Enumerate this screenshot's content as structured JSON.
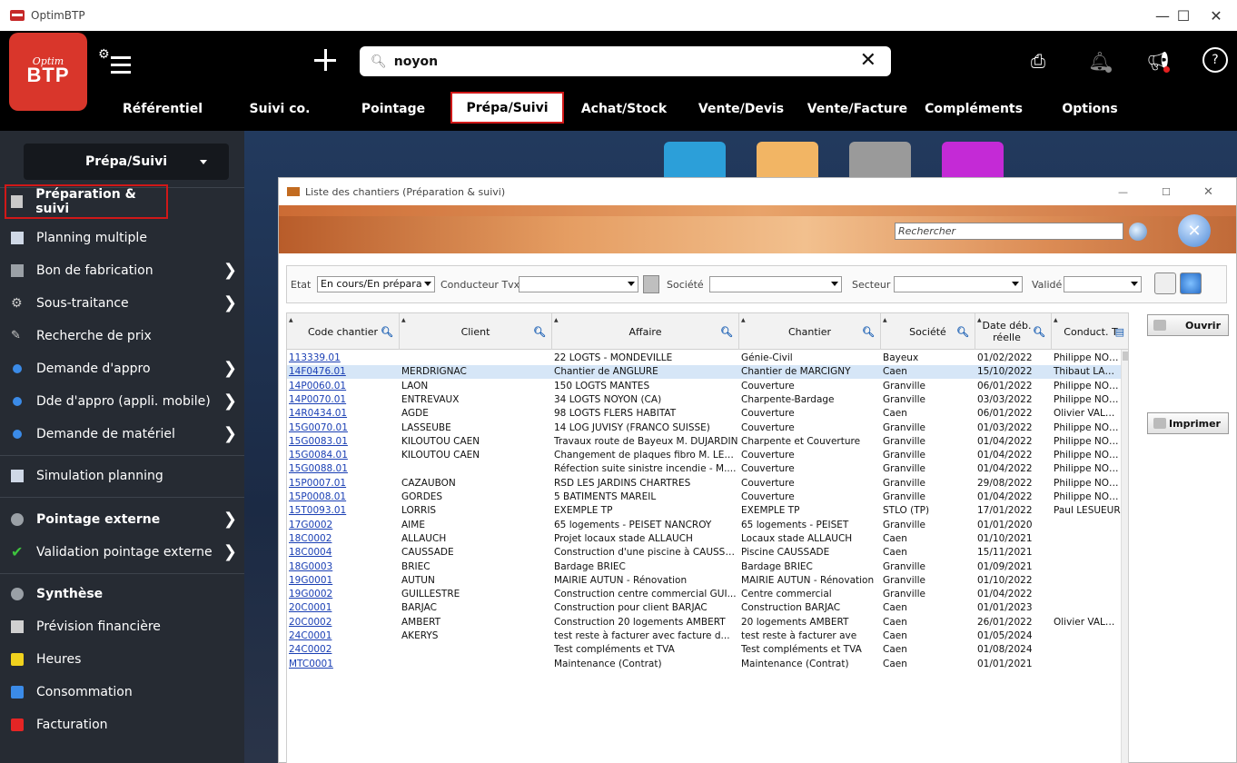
{
  "app": {
    "title": "OptimBTP",
    "logo_small": "Optim",
    "logo_big": "BTP"
  },
  "search": {
    "value": "noyon",
    "placeholder": ""
  },
  "nav": [
    {
      "label": "Référentiel"
    },
    {
      "label": "Suivi co."
    },
    {
      "label": "Pointage"
    },
    {
      "label": "Prépa/Suivi"
    },
    {
      "label": "Achat/Stock"
    },
    {
      "label": "Vente/Devis"
    },
    {
      "label": "Vente/Facture"
    },
    {
      "label": "Compléments"
    },
    {
      "label": "Options"
    }
  ],
  "sidebar": {
    "dropdown": "Prépa/Suivi",
    "items": [
      {
        "label": "Préparation & suivi",
        "icon": "folder-icon"
      },
      {
        "label": "Planning multiple",
        "icon": "planning-icon"
      },
      {
        "label": "Bon de fabrication",
        "icon": "factory-icon"
      },
      {
        "label": "Sous-traitance",
        "icon": "gear-icon"
      },
      {
        "label": "Recherche de prix",
        "icon": "tag-icon"
      },
      {
        "label": "Demande d'appro",
        "icon": "circle-icon"
      },
      {
        "label": "Dde d'appro (appli. mobile)",
        "icon": "circle-icon"
      },
      {
        "label": "Demande de matériel",
        "icon": "circle-icon"
      },
      {
        "label": "Simulation planning",
        "icon": "planning-icon"
      },
      {
        "label": "Pointage externe",
        "icon": "clock-icon"
      },
      {
        "label": "Validation pointage externe",
        "icon": "check-icon"
      },
      {
        "label": "Synthèse",
        "icon": "chart-icon"
      },
      {
        "label": "Prévision financière",
        "icon": "calc-icon"
      },
      {
        "label": "Heures",
        "icon": "yellow-square-icon"
      },
      {
        "label": "Consommation",
        "icon": "blue-square-icon"
      },
      {
        "label": "Facturation",
        "icon": "red-square-icon"
      }
    ]
  },
  "window": {
    "title": "Liste des chantiers (Préparation & suivi)",
    "search_placeholder": "Rechercher"
  },
  "filters": {
    "etat_label": "Etat",
    "etat_value": "En cours/En prépara",
    "conducteur_label": "Conducteur Tvx",
    "societe_label": "Société",
    "secteur_label": "Secteur",
    "valide_label": "Validé"
  },
  "buttons": {
    "ouvrir": "Ouvrir",
    "imprimer": "Imprimer"
  },
  "table": {
    "headers": [
      "Code chantier",
      "Client",
      "Affaire",
      "Chantier",
      "Société",
      "Date déb. réelle",
      "Conduct. T"
    ],
    "rows": [
      [
        "113339.01",
        "",
        "22 LOGTS - MONDEVILLE",
        "Génie-Civil",
        "Bayeux",
        "01/02/2022",
        "Philippe NORMAN"
      ],
      [
        "14F0476.01",
        "MERDRIGNAC",
        "Chantier de ANGLURE",
        "Chantier de MARCIGNY",
        "Caen",
        "15/10/2022",
        "Thibaut LAURENT"
      ],
      [
        "14P0060.01",
        "LAON",
        "150 LOGTS MANTES",
        "Couverture",
        "Granville",
        "06/01/2022",
        "Philippe NORMAN"
      ],
      [
        "14P0070.01",
        "ENTREVAUX",
        "34 LOGTS NOYON (CA)",
        "Charpente-Bardage",
        "Granville",
        "03/03/2022",
        "Philippe NORMAN"
      ],
      [
        "14R0434.01",
        "AGDE",
        "98 LOGTS FLERS HABITAT",
        "Couverture",
        "Caen",
        "06/01/2022",
        "Olivier VALDORG"
      ],
      [
        "15G0070.01",
        "LASSEUBE",
        "14 LOG JUVISY (FRANCO SUISSE)",
        "Couverture",
        "Granville",
        "01/03/2022",
        "Philippe NORMAN"
      ],
      [
        "15G0083.01",
        "KILOUTOU CAEN",
        "Travaux route de Bayeux M. DUJARDIN",
        "Charpente et Couverture",
        "Granville",
        "01/04/2022",
        "Philippe NORMAN"
      ],
      [
        "15G0084.01",
        "KILOUTOU CAEN",
        "Changement de plaques fibro M. LEN...",
        "Couverture",
        "Granville",
        "01/04/2022",
        "Philippe NORMAN"
      ],
      [
        "15G0088.01",
        "",
        "Réfection suite sinistre incendie - M....",
        "Couverture",
        "Granville",
        "01/04/2022",
        "Philippe NORMAN"
      ],
      [
        "15P0007.01",
        "CAZAUBON",
        "RSD LES JARDINS CHARTRES",
        "Couverture",
        "Granville",
        "29/08/2022",
        "Philippe NORMAN"
      ],
      [
        "15P0008.01",
        "GORDES",
        "5 BATIMENTS MAREIL",
        "Couverture",
        "Granville",
        "01/04/2022",
        "Philippe NORMAN"
      ],
      [
        "15T0093.01",
        "LORRIS",
        "EXEMPLE TP",
        "EXEMPLE TP",
        "STLO (TP)",
        "17/01/2022",
        "Paul LESUEUR"
      ],
      [
        "17G0002",
        "AIME",
        "65 logements - PEISET NANCROY",
        "65 logements - PEISET",
        "Granville",
        "01/01/2020",
        ""
      ],
      [
        "18C0002",
        "ALLAUCH",
        "Projet locaux stade ALLAUCH",
        "Locaux stade ALLAUCH",
        "Caen",
        "01/10/2021",
        ""
      ],
      [
        "18C0004",
        "CAUSSADE",
        "Construction d'une piscine à CAUSSADE",
        "Piscine CAUSSADE",
        "Caen",
        "15/11/2021",
        ""
      ],
      [
        "18G0003",
        "BRIEC",
        "Bardage BRIEC",
        "Bardage BRIEC",
        "Granville",
        "01/09/2021",
        ""
      ],
      [
        "19G0001",
        "AUTUN",
        "MAIRIE AUTUN - Rénovation",
        "MAIRIE AUTUN - Rénovation",
        "Granville",
        "01/10/2022",
        ""
      ],
      [
        "19G0002",
        "GUILLESTRE",
        "Construction centre commercial GUI...",
        "Centre commercial",
        "Granville",
        "01/04/2022",
        ""
      ],
      [
        "20C0001",
        "BARJAC",
        "Construction pour client BARJAC",
        "Construction BARJAC",
        "Caen",
        "01/01/2023",
        ""
      ],
      [
        "20C0002",
        "AMBERT",
        "Construction 20 logements AMBERT",
        "20 logements AMBERT",
        "Caen",
        "26/01/2022",
        "Olivier VALDORG"
      ],
      [
        "24C0001",
        "AKERYS",
        "test reste à facturer avec facture d...",
        "test reste à facturer ave",
        "Caen",
        "01/05/2024",
        ""
      ],
      [
        "24C0002",
        "",
        "Test compléments et TVA",
        "Test compléments et TVA",
        "Caen",
        "01/08/2024",
        ""
      ],
      [
        "MTC0001",
        "",
        "Maintenance (Contrat)",
        "Maintenance (Contrat)",
        "Caen",
        "01/01/2021",
        ""
      ]
    ]
  },
  "colors": {
    "accent_red": "#d01818",
    "link_blue": "#1a3fb4",
    "selected_row": "#d6e6f7"
  }
}
